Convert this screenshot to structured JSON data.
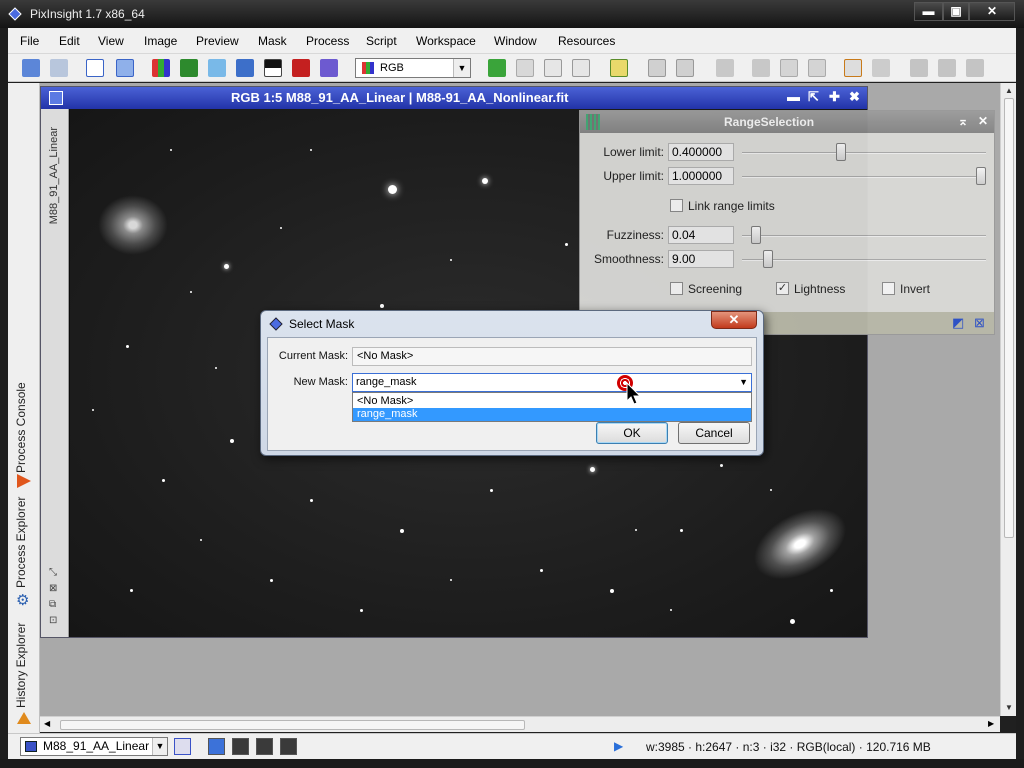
{
  "app": {
    "title": "PixInsight 1.7 x86_64"
  },
  "window_controls": {
    "minimize": "▬",
    "maximize": "▣",
    "close": "✕"
  },
  "menu": {
    "items": [
      "File",
      "Edit",
      "View",
      "Image",
      "Preview",
      "Mask",
      "Process",
      "Script",
      "Workspace",
      "Window",
      "Resources"
    ]
  },
  "toolbar": {
    "channel_select": "RGB"
  },
  "side_panel": {
    "tabs": [
      "Process Console",
      "Process Explorer",
      "History Explorer"
    ]
  },
  "image_window": {
    "title": "RGB 1:5 M88_91_AA_Linear | M88-91_AA_Nonlinear.fit",
    "view_tab": "M88_91_AA_Linear",
    "controls": {
      "minimize": "▬",
      "shade": "⇱",
      "maximize": "✚",
      "close": "✖"
    }
  },
  "range_selection": {
    "title": "RangeSelection",
    "lower_limit": {
      "label": "Lower limit:",
      "value": "0.400000",
      "slider_fraction": 0.4
    },
    "upper_limit": {
      "label": "Upper limit:",
      "value": "1.000000",
      "slider_fraction": 1.0
    },
    "link_range_limits": {
      "label": "Link range limits",
      "checked": false
    },
    "fuzziness": {
      "label": "Fuzziness:",
      "value": "0.04",
      "slider_fraction": 0.04
    },
    "smoothness": {
      "label": "Smoothness:",
      "value": "9.00",
      "slider_fraction": 0.09
    },
    "screening": {
      "label": "Screening",
      "checked": false
    },
    "lightness": {
      "label": "Lightness",
      "checked": true
    },
    "invert": {
      "label": "Invert",
      "checked": false
    }
  },
  "select_mask_dialog": {
    "title": "Select Mask",
    "current_mask_label": "Current Mask:",
    "current_mask_value": "<No Mask>",
    "new_mask_label": "New Mask:",
    "new_mask_value": "range_mask",
    "options": [
      "<No Mask>",
      "range_mask"
    ],
    "selected_option": "range_mask",
    "ok_label": "OK",
    "cancel_label": "Cancel"
  },
  "status_bar": {
    "view_name": "M88_91_AA_Linear",
    "info": "w:3985 · h:2647 · n:3 · i32 · RGB(local) · 120.716 MB"
  },
  "colors": {
    "accent_blue": "#2a3fbf",
    "selection": "#3399ff",
    "close_red": "#c23a1c"
  }
}
